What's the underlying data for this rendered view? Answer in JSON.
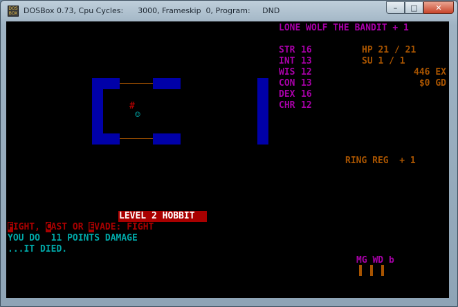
{
  "window": {
    "title": "DOSBox 0.73, Cpu Cycles:      3000, Frameskip  0, Program:     DND",
    "icon_text": "DOS BOX",
    "buttons": {
      "minimize": "–",
      "maximize": "□",
      "close": "✕"
    }
  },
  "character": {
    "name": "LONE WOLF THE BANDIT + 1",
    "stats": [
      {
        "name": "STR",
        "value": "16"
      },
      {
        "name": "INT",
        "value": "13"
      },
      {
        "name": "WIS",
        "value": "12"
      },
      {
        "name": "CON",
        "value": "13"
      },
      {
        "name": "DEX",
        "value": "16"
      },
      {
        "name": "CHR",
        "value": "12"
      }
    ],
    "hp": "HP 21 / 21",
    "su": "SU 1 / 1",
    "ex": "446 EX",
    "gd": "$0 GD",
    "item": "RING REG  + 1"
  },
  "map": {
    "monster_glyph": "#",
    "player_glyph": "☺"
  },
  "encounter": {
    "level_banner": "LEVEL 2 HOBBIT",
    "prompt": {
      "f_key": "F",
      "f_rest": "IGHT, ",
      "c_key": "C",
      "c_rest": "AST OR ",
      "e_key": "E",
      "e_rest": "VADE: ",
      "choice": "FIGHT"
    },
    "message1": "YOU DO  11 POINTS DAMAGE",
    "message2": "...IT DIED."
  },
  "indicators": {
    "labels": "MG WD b"
  },
  "colors": {
    "purple": "#a800a8",
    "orange": "#a85400",
    "cyan": "#00a8a8",
    "red": "#a80000",
    "blue": "#0000a8"
  }
}
